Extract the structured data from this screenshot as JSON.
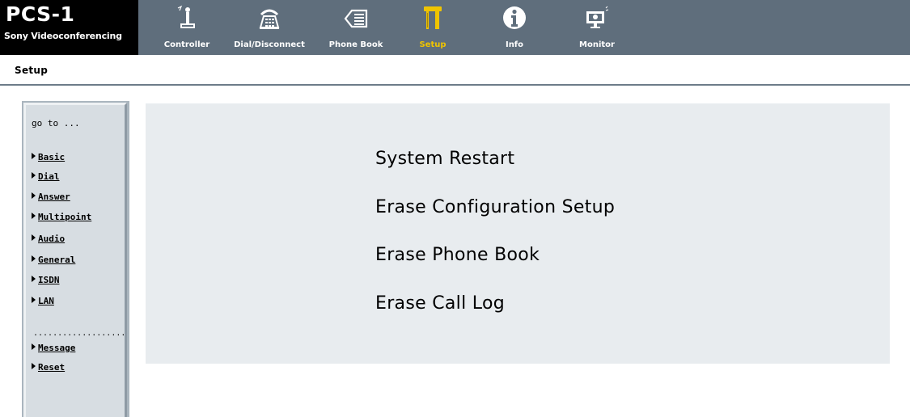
{
  "brand": {
    "title": "PCS-1",
    "subtitle": "Sony Videoconferencing"
  },
  "nav": [
    {
      "label": "Controller",
      "icon": "controller-icon"
    },
    {
      "label": "Dial/Disconnect",
      "icon": "dial-icon"
    },
    {
      "label": "Phone Book",
      "icon": "phone-book-icon"
    },
    {
      "label": "Setup",
      "icon": "setup-icon",
      "active": true
    },
    {
      "label": "Info",
      "icon": "info-icon"
    },
    {
      "label": "Monitor",
      "icon": "monitor-icon"
    }
  ],
  "page": {
    "title": "Setup"
  },
  "sidebar": {
    "heading": "go to ...",
    "items": [
      {
        "label": "Basic"
      },
      {
        "label": "Dial"
      },
      {
        "label": "Answer"
      },
      {
        "label": "Multipoint"
      },
      {
        "label": "Audio"
      },
      {
        "label": "General"
      },
      {
        "label": "ISDN"
      },
      {
        "label": "LAN"
      }
    ],
    "separator": "...................",
    "extra_items": [
      {
        "label": "Message"
      },
      {
        "label": "Reset"
      }
    ]
  },
  "main": {
    "actions": [
      {
        "label": "System Restart"
      },
      {
        "label": "Erase Configuration Setup"
      },
      {
        "label": "Erase Phone Book"
      },
      {
        "label": "Erase Call Log"
      }
    ]
  },
  "colors": {
    "topbar": "#5f6e7c",
    "brand_bg": "#000000",
    "active_label": "#f0c400",
    "sidebar_bg": "#d7dde2",
    "main_bg": "#e8ecef"
  }
}
